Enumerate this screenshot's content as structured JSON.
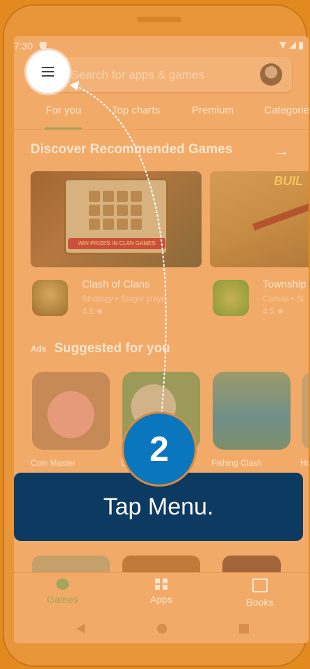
{
  "status_bar": {
    "time": "7:30"
  },
  "search": {
    "placeholder": "Search for apps & games"
  },
  "tabs": [
    {
      "label": "For you",
      "active": true
    },
    {
      "label": "Top charts"
    },
    {
      "label": "Premium"
    },
    {
      "label": "Categories"
    }
  ],
  "sections": {
    "discover": {
      "title": "Discover Recommended Games"
    },
    "suggested": {
      "ads_label": "Ads",
      "title": "Suggested for you"
    }
  },
  "featured_cards": {
    "coc_banner": "WIN PRIZES IN CLAN GAMES",
    "township_banner": "BUIL"
  },
  "featured_apps": [
    {
      "name": "Clash of Clans",
      "subtitle": "Strategy • Single playe",
      "rating": "4.5 ★"
    },
    {
      "name": "Township",
      "subtitle": "Casual • Si",
      "rating": "4.5 ★"
    }
  ],
  "suggested_apps": [
    {
      "name": "Coin Master"
    },
    {
      "name": "G"
    },
    {
      "name": "Fishing Clash"
    },
    {
      "name": "Ho"
    }
  ],
  "bottom_nav": [
    {
      "label": "Games",
      "icon": "gamepad-icon",
      "active": true
    },
    {
      "label": "Apps",
      "icon": "apps-grid-icon"
    },
    {
      "label": "Books",
      "icon": "book-icon"
    }
  ],
  "overlay": {
    "step_number": "2",
    "instruction": "Tap Menu.",
    "overlay_color": "#e28a1e",
    "badge_color": "#0a76be",
    "callout_color": "#0c3a61"
  }
}
